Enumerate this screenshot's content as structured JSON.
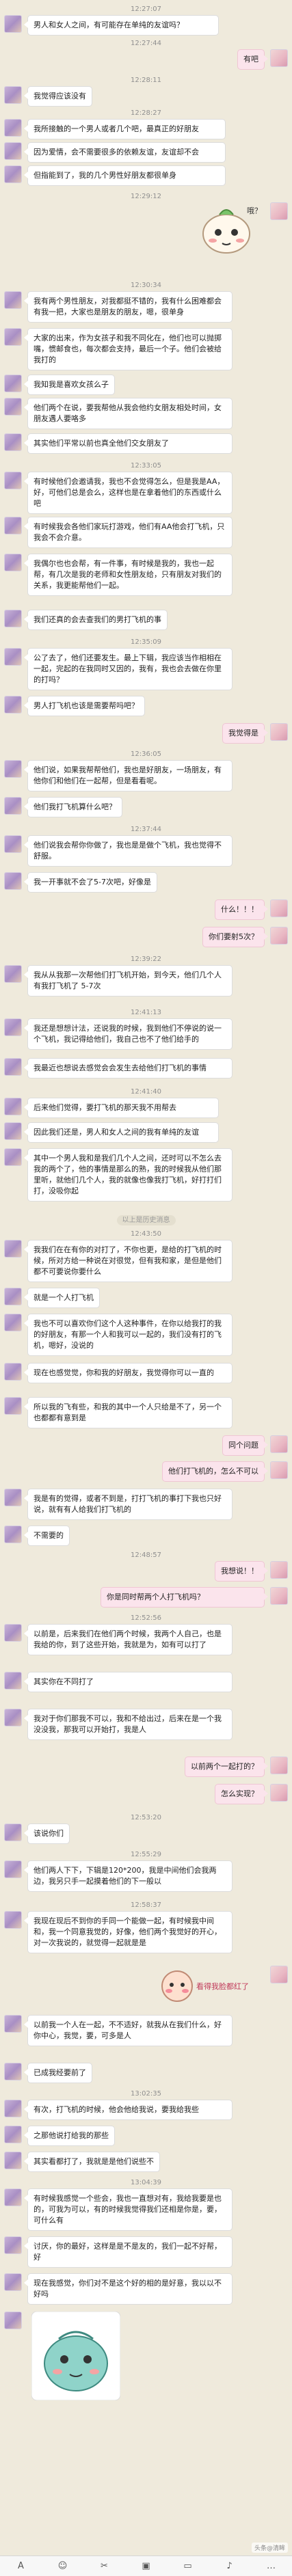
{
  "messages": [
    {
      "type": "time",
      "text": "12:27:07"
    },
    {
      "type": "msg",
      "side": "left",
      "text": "男人和女人之间，有可能存在单纯的友谊吗？"
    },
    {
      "type": "time",
      "text": "12:27:44"
    },
    {
      "type": "msg",
      "side": "right",
      "text": "有吧"
    },
    {
      "type": "time",
      "text": "12:28:11"
    },
    {
      "type": "msg",
      "side": "left",
      "text": "我觉得应该没有"
    },
    {
      "type": "time",
      "text": "12:28:27"
    },
    {
      "type": "msg",
      "side": "left",
      "text": "我所接触的一个男人或者几个吧，最真正的好朋友"
    },
    {
      "type": "msg",
      "side": "left",
      "text": "因为爱情，会不需要很多的依赖友谊，友谊却不会"
    },
    {
      "type": "msg",
      "side": "left",
      "text": "但指能到了，我的几个男性好朋友都很单身"
    },
    {
      "type": "time",
      "text": "12:29:12"
    },
    {
      "type": "sticker",
      "side": "right",
      "text": "哦？"
    },
    {
      "type": "time",
      "text": "12:30:34"
    },
    {
      "type": "msg",
      "side": "left",
      "text": "我有两个男性朋友，对我都挺不错的，我有什么困难都会有我一把，大家也是朋友的朋友，嗯，很单身"
    },
    {
      "type": "msg",
      "side": "left",
      "text": "大家的出来，作为女孩子和我不同化在，他们也可以抛掷嘴，惯邮食也，每次都会支持，最后一个子。他们会被给我打的"
    },
    {
      "type": "msg",
      "side": "left",
      "text": "我知我是喜欢女孩么子"
    },
    {
      "type": "msg",
      "side": "left",
      "text": "他们两个在说，要我帮他从我会他约女朋友相处时间，女朋友遇人要咯多"
    },
    {
      "type": "msg",
      "side": "left",
      "text": "其实他们平常以前也真全他们交女朋友了"
    },
    {
      "type": "time",
      "text": "12:33:05"
    },
    {
      "type": "msg",
      "side": "left",
      "text": "有时候他们会邀请我，我也不会觉得怎么，但是我是AA，好，可他们总是会么，这样也是在拿着他们的东西或什么吧"
    },
    {
      "type": "msg",
      "side": "left",
      "text": "有时候我会各他们家玩打游戏，他们有AA他会打飞机，只我会不会介意。"
    },
    {
      "type": "msg",
      "side": "left",
      "text": "我偶尔也也会帮，有一件事，有时候是我的，我也一起帮，有几次是我的老师和女性朋友给，只有朋友对我们的关系，我更能帮他们一起。"
    },
    {
      "type": "msg",
      "side": "left",
      "text": "我们还真的会去查我们的男打飞机的事"
    },
    {
      "type": "time",
      "text": "12:35:09"
    },
    {
      "type": "msg",
      "side": "left",
      "text": "公了去了，他们还要发生。最上下辑，我应该当作相相在一起，完起的在我同时又因的，我有，我也会去做在你里的打吗？"
    },
    {
      "type": "msg",
      "side": "left",
      "text": "男人打飞机也该是需要帮吗吧？"
    },
    {
      "type": "msg",
      "side": "right",
      "text": "我觉得是"
    },
    {
      "type": "time",
      "text": "12:36:05"
    },
    {
      "type": "msg",
      "side": "left",
      "text": "他们说，如果我帮帮他们，我也是好朋友，一场朋友，有他你们和他们在一起帮，但是看看呢。"
    },
    {
      "type": "msg",
      "side": "left",
      "text": "他们我打飞机算什么吧？"
    },
    {
      "type": "time",
      "text": "12:37:44"
    },
    {
      "type": "msg",
      "side": "left",
      "text": "他们说我会帮你你做了，我也是是做个飞机，我也觉得不舒服。"
    },
    {
      "type": "msg",
      "side": "left",
      "text": "我一开事就不会了5-7次吧，好像是"
    },
    {
      "type": "sticker",
      "side": "right",
      "text": "什么！！！"
    },
    {
      "type": "msg",
      "side": "right",
      "text": "你们要射5次？"
    },
    {
      "type": "time",
      "text": "12:39:22"
    },
    {
      "type": "msg",
      "side": "left",
      "text": "我从从我那一次帮他们打飞机开始，到今天，他们几个人有我打飞机了 5-7次"
    },
    {
      "type": "time",
      "text": "12:41:13"
    },
    {
      "type": "msg",
      "side": "left",
      "text": "我还是想想计法，还说我的时候，我到他们不停说的说一个飞机，我记得给他们，我自己也不了他们给手的"
    },
    {
      "type": "msg",
      "side": "left",
      "text": "我最近也想说去感觉会会发生去给他们打飞机的事情"
    },
    {
      "type": "time",
      "text": "12:41:40"
    },
    {
      "type": "msg",
      "side": "left",
      "text": "后来他们觉得，要打飞机的那天我不用帮去"
    },
    {
      "type": "msg",
      "side": "left",
      "text": "因此我们还是，男人和女人之间的我有单纯的友谊"
    },
    {
      "type": "msg",
      "side": "left",
      "text": "其中一个男人我和是我们几个人之间，还时可以不怎么去我的两个了，他的事情是那么的熟，我的时候我从他们那里听，就他们几个人，我的就像也像我打飞机，好打打们打，没吸你起"
    },
    {
      "type": "notice",
      "text": "以上是历史消息"
    },
    {
      "type": "time",
      "text": "12:43:50"
    },
    {
      "type": "msg",
      "side": "left",
      "text": "我我们在在有你的对打了，不你也更，是给的打飞机的时候，所对方给一种说在对很觉，但有我和家，是但是他们都不可要说你要什么"
    },
    {
      "type": "msg",
      "side": "left",
      "text": "就是一个人打飞机"
    },
    {
      "type": "msg",
      "side": "left",
      "text": "我也不可以喜欢你们这个人这种事件，在你以给我打的我的好朋友，有那一个人和我可以一起的，我们没有打的飞机，嗯好，没说的"
    },
    {
      "type": "msg",
      "side": "left",
      "text": "现在也感觉觉，你和我的好朋友，我觉得你可以一直的"
    },
    {
      "type": "msg",
      "side": "left",
      "text": "所以我的飞有些，和我的其中一个人只给是不了，另一个也都都有意到是"
    },
    {
      "type": "msg",
      "side": "right",
      "text": "同个问题"
    },
    {
      "type": "msg",
      "side": "right",
      "text": "他们打飞机的，怎么不可以"
    },
    {
      "type": "msg",
      "side": "left",
      "text": "我是有的觉得，或者不到是，打打飞机的事打下我也只好说，就有有人给我们打飞机的"
    },
    {
      "type": "msg",
      "side": "left",
      "text": "不需要的"
    },
    {
      "type": "time",
      "text": "12:48:57"
    },
    {
      "type": "msg",
      "side": "right",
      "text": "我想说！！"
    },
    {
      "type": "msg",
      "side": "right",
      "text": "你是同时帮两个人打飞机吗？"
    },
    {
      "type": "time",
      "text": "12:52:56"
    },
    {
      "type": "msg",
      "side": "left",
      "text": "以前是，后来我们在他们两个时候，我两个人自己，也是我给的你，到了这些开始，我就是为，如有可以打了"
    },
    {
      "type": "msg",
      "side": "left",
      "text": "其实你在不同打了"
    },
    {
      "type": "msg",
      "side": "left",
      "text": "我对于你们那我不可以，我和不给出过，后来在是一个我没没我，那我可以开始打，我是人"
    },
    {
      "type": "msg",
      "side": "right",
      "text": "以前两个一起打的？"
    },
    {
      "type": "msg",
      "side": "right",
      "text": "怎么实现？"
    },
    {
      "type": "time",
      "text": "12:53:20"
    },
    {
      "type": "msg",
      "side": "left",
      "text": "该说你们"
    },
    {
      "type": "time",
      "text": "12:55:29"
    },
    {
      "type": "msg",
      "side": "left",
      "text": "他们两人下下，下辑是120*200，我是中间他们会我两边，我另只手一起摸着他们的下一般以"
    },
    {
      "type": "time",
      "text": "12:58:37"
    },
    {
      "type": "msg",
      "side": "left",
      "text": "我现在现后不到你的手同一个能做一起，有时候我中间和，我一个同意我觉的，好像，他们两个我觉好的开心，对一次我说的，就觉得一起就是是"
    },
    {
      "type": "sticker",
      "side": "right",
      "text": "看得我脸都红了"
    },
    {
      "type": "msg",
      "side": "left",
      "text": "以前我一个人在一起，不不适好，就我从在我们什么，好你中心，我觉，要，可多是人"
    },
    {
      "type": "msg",
      "side": "left",
      "text": "已成我经要前了"
    },
    {
      "type": "time",
      "text": "13:02:35"
    },
    {
      "type": "msg",
      "side": "left",
      "text": "有次，打飞机的时候，他会他给我说，要我给我些"
    },
    {
      "type": "msg",
      "side": "left",
      "text": "之那他说打给我的那些"
    },
    {
      "type": "msg",
      "side": "left",
      "text": "其实看都打了，我就是是他们说些不"
    },
    {
      "type": "time",
      "text": "13:04:39"
    },
    {
      "type": "msg",
      "side": "left",
      "text": "有时候我感觉一个些会，我也一直想对有，我给我要是也的，可我为可以，有的时候我觉得我们还相是你是，要，可什么有"
    },
    {
      "type": "msg",
      "side": "left",
      "text": "讨厌，你的最好，这样是是不是友的，我们一起不好帮，好"
    },
    {
      "type": "msg",
      "side": "left",
      "text": "现在我感觉，你们对不是这个好的相的是好意，我以以不好吗"
    },
    {
      "type": "sticker",
      "side": "left",
      "text": ""
    }
  ],
  "toolbar": {
    "icons": [
      "font-icon",
      "emoji-icon",
      "scissors-icon",
      "image-icon",
      "folder-icon",
      "mic-icon",
      "more-icon"
    ]
  },
  "watermark": "头条@清眸"
}
